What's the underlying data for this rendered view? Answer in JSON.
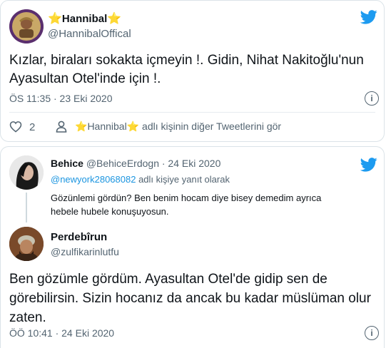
{
  "main_tweet": {
    "star_left": "⭐",
    "name": "Hannibal",
    "star_right": "⭐",
    "handle": "@HannibalOffical",
    "text_line1": "Kızlar, biraları sokakta içmeyin !. Gidin, Nihat Nakitoğlu'nun",
    "text_line2": "Ayasultan Otel'inde için !.",
    "timestamp": "ÖS 11:35 · 23 Eki 2020",
    "like_count": "2",
    "more_prefix": "⭐",
    "more_name": "Hannibal",
    "more_suffix": "⭐",
    "more_text": "adlı kişinin diğer Tweetlerini gör"
  },
  "reply_tweet": {
    "name": "Behice",
    "handle_and_date": "@BehiceErdogn · 24 Eki 2020",
    "reply_to_handle": "@newyork28068082",
    "reply_to_text": " adlı kişiye yanıt olarak",
    "text_line1": "Gözünlemi gördün? Ben benim hocam diye bisey demedim ayrıca",
    "text_line2": "hebele hubele konuşuyosun."
  },
  "answer_tweet": {
    "name": "Perdebîrun",
    "handle": "@zulfikarinlutfu",
    "text_line1": "Ben gözümle gördüm. Ayasultan Otel'de gidip sen de",
    "text_line2": "görebilirsin. Sizin hocanız da ancak bu kadar müslüman olur",
    "text_line3": "zaten.",
    "timestamp": "ÖÖ 10:41 · 24 Eki 2020"
  },
  "colors": {
    "twitter_blue": "#1d9bf0",
    "star": "#f4b400",
    "secondary": "#536471"
  },
  "icons": [
    "twitter-bird-icon",
    "heart-icon",
    "person-icon",
    "info-icon",
    "star-icon"
  ]
}
